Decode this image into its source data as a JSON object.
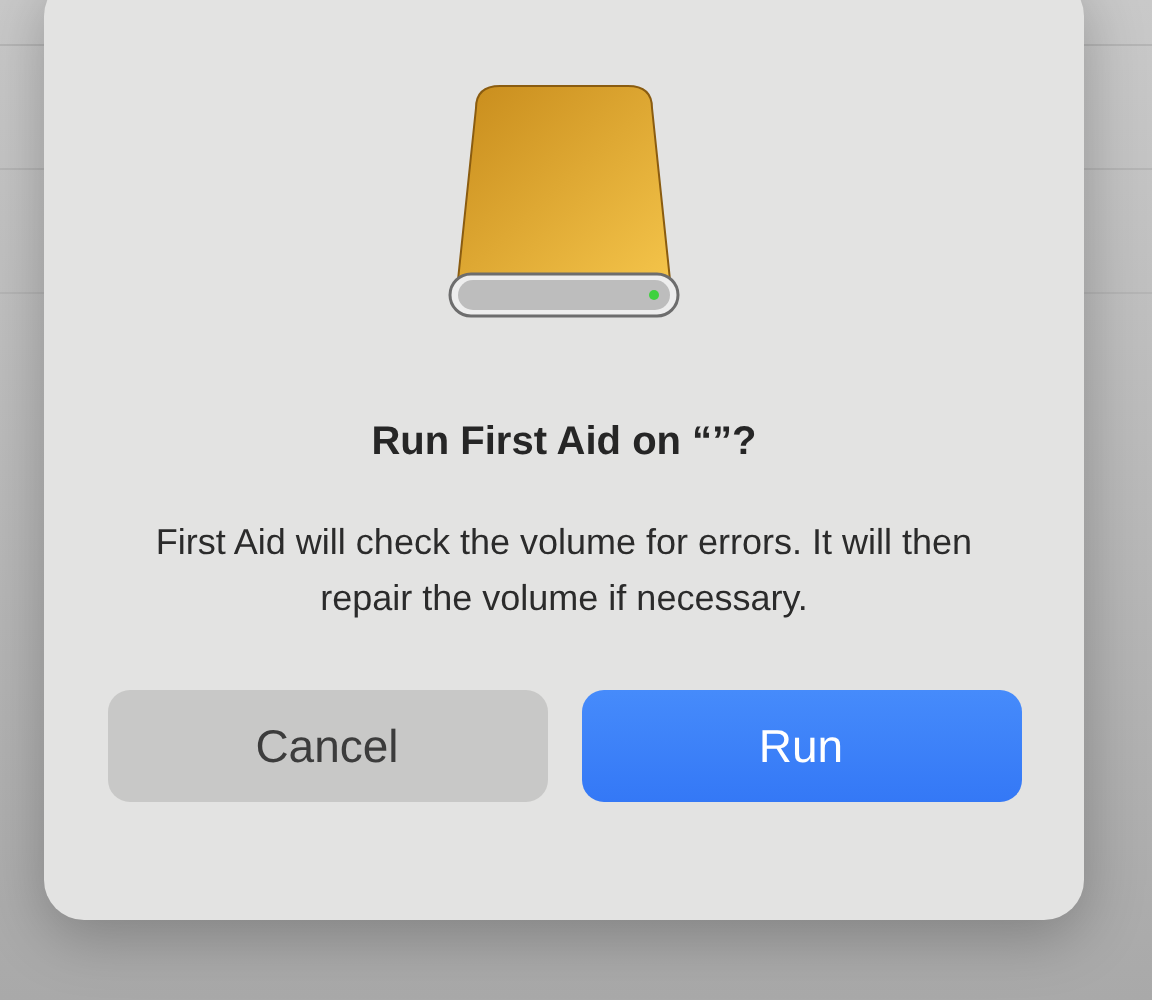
{
  "dialog": {
    "title": "Run First Aid on “”?",
    "message": "First Aid will check the volume for errors. It will then repair the volume if necessary.",
    "buttons": [
      {
        "label": "Cancel",
        "kind": "secondary"
      },
      {
        "label": "Run",
        "kind": "primary"
      }
    ]
  }
}
